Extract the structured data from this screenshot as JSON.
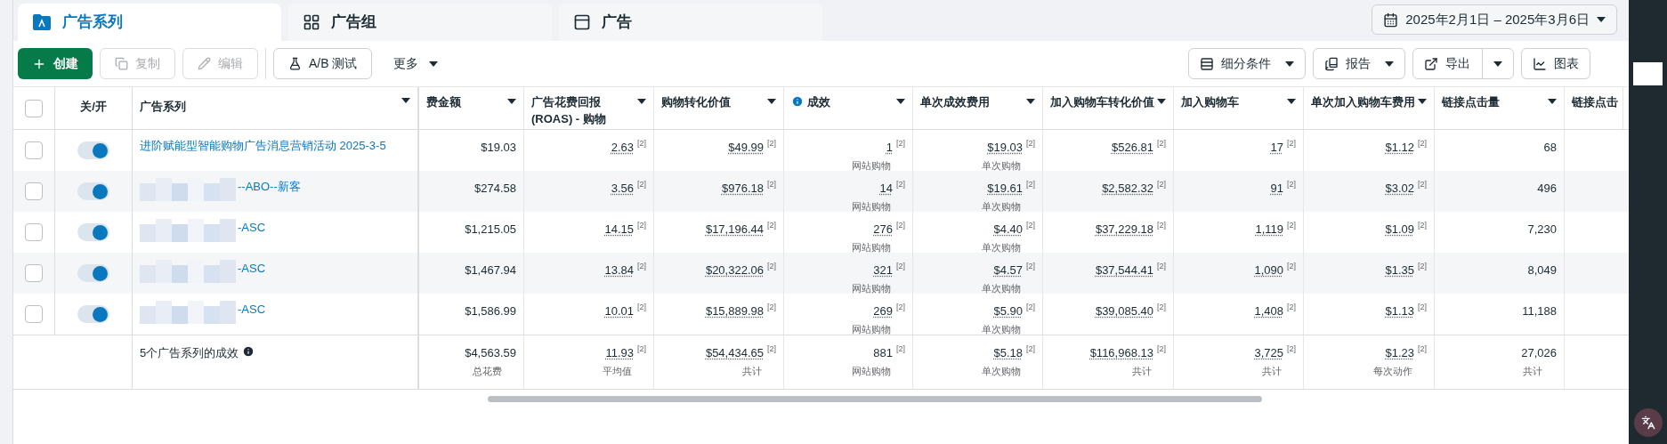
{
  "tabs": [
    {
      "label": "广告系列",
      "kind": "campaign",
      "selected": true
    },
    {
      "label": "广告组",
      "kind": "adset",
      "selected": false
    },
    {
      "label": "广告",
      "kind": "ad",
      "selected": false
    }
  ],
  "date_range": "2025年2月1日 – 2025年3月6日",
  "toolbar_left": [
    {
      "label": "创建",
      "kind": "create",
      "disabled": false
    },
    {
      "label": "复制",
      "kind": "copy",
      "disabled": true
    },
    {
      "label": "编辑",
      "kind": "edit",
      "disabled": true
    },
    {
      "label": "A/B 测试",
      "kind": "ab",
      "disabled": false
    },
    {
      "label": "更多",
      "kind": "more",
      "disabled": false
    }
  ],
  "toolbar_right": [
    {
      "label": "细分条件",
      "kind": "breakdown"
    },
    {
      "label": "报告",
      "kind": "report"
    },
    {
      "label": "导出",
      "kind": "export"
    },
    {
      "label": "图表",
      "kind": "chart"
    }
  ],
  "table": {
    "select_all_checked": false,
    "toggle_header": "关/开",
    "name_header": "广告系列",
    "columns": [
      {
        "label": "费金额"
      },
      {
        "label": "广告花费回报 (ROAS) - 购物"
      },
      {
        "label": "购物转化价值"
      },
      {
        "label": "成效",
        "info": true
      },
      {
        "label": "单次成效费用"
      },
      {
        "label": "加入购物车转化价值"
      },
      {
        "label": "加入购物车"
      },
      {
        "label": "单次加入购物车费用"
      },
      {
        "label": "链接点击量"
      },
      {
        "label": "链接点击"
      }
    ],
    "rows": [
      {
        "checked": false,
        "on": true,
        "name": "进阶赋能型智能购物广告消息营销活动 2025-3-5",
        "redacted": false,
        "cells": [
          {
            "text": "$19.03",
            "dotted": false
          },
          {
            "text": "2.63",
            "note": "[2]",
            "dotted": true
          },
          {
            "text": "$49.99",
            "note": "[2]",
            "dotted": true
          },
          {
            "text": "1",
            "note": "[2]",
            "sub": "网站购物",
            "dotted": true
          },
          {
            "text": "$19.03",
            "note": "[2]",
            "sub": "单次购物",
            "dotted": true
          },
          {
            "text": "$526.81",
            "note": "[2]",
            "dotted": true
          },
          {
            "text": "17",
            "note": "[2]",
            "dotted": true
          },
          {
            "text": "$1.12",
            "note": "[2]",
            "dotted": true
          },
          {
            "text": "68",
            "dotted": false
          }
        ]
      },
      {
        "checked": false,
        "on": true,
        "name": "--ABO--新客",
        "redacted": true,
        "cells": [
          {
            "text": "$274.58",
            "dotted": false
          },
          {
            "text": "3.56",
            "note": "[2]",
            "dotted": true
          },
          {
            "text": "$976.18",
            "note": "[2]",
            "dotted": true
          },
          {
            "text": "14",
            "note": "[2]",
            "sub": "网站购物",
            "dotted": true
          },
          {
            "text": "$19.61",
            "note": "[2]",
            "sub": "单次购物",
            "dotted": true
          },
          {
            "text": "$2,582.32",
            "note": "[2]",
            "dotted": true
          },
          {
            "text": "91",
            "note": "[2]",
            "dotted": true
          },
          {
            "text": "$3.02",
            "note": "[2]",
            "dotted": true
          },
          {
            "text": "496",
            "dotted": false
          }
        ]
      },
      {
        "checked": false,
        "on": true,
        "name": "-ASC",
        "redacted": true,
        "cells": [
          {
            "text": "$1,215.05",
            "dotted": false
          },
          {
            "text": "14.15",
            "note": "[2]",
            "dotted": true
          },
          {
            "text": "$17,196.44",
            "note": "[2]",
            "dotted": true
          },
          {
            "text": "276",
            "note": "[2]",
            "sub": "网站购物",
            "dotted": true
          },
          {
            "text": "$4.40",
            "note": "[2]",
            "sub": "单次购物",
            "dotted": true
          },
          {
            "text": "$37,229.18",
            "note": "[2]",
            "dotted": true
          },
          {
            "text": "1,119",
            "note": "[2]",
            "dotted": true
          },
          {
            "text": "$1.09",
            "note": "[2]",
            "dotted": true
          },
          {
            "text": "7,230",
            "dotted": false
          }
        ]
      },
      {
        "checked": false,
        "on": true,
        "name": "-ASC",
        "redacted": true,
        "cells": [
          {
            "text": "$1,467.94",
            "dotted": false
          },
          {
            "text": "13.84",
            "note": "[2]",
            "dotted": true
          },
          {
            "text": "$20,322.06",
            "note": "[2]",
            "dotted": true
          },
          {
            "text": "321",
            "note": "[2]",
            "sub": "网站购物",
            "dotted": true
          },
          {
            "text": "$4.57",
            "note": "[2]",
            "sub": "单次购物",
            "dotted": true
          },
          {
            "text": "$37,544.41",
            "note": "[2]",
            "dotted": true
          },
          {
            "text": "1,090",
            "note": "[2]",
            "dotted": true
          },
          {
            "text": "$1.35",
            "note": "[2]",
            "dotted": true
          },
          {
            "text": "8,049",
            "dotted": false
          }
        ]
      },
      {
        "checked": false,
        "on": true,
        "name": "-ASC",
        "redacted": true,
        "cells": [
          {
            "text": "$1,586.99",
            "dotted": false
          },
          {
            "text": "10.01",
            "note": "[2]",
            "dotted": true
          },
          {
            "text": "$15,889.98",
            "note": "[2]",
            "dotted": true
          },
          {
            "text": "269",
            "note": "[2]",
            "sub": "网站购物",
            "dotted": true
          },
          {
            "text": "$5.90",
            "note": "[2]",
            "sub": "单次购物",
            "dotted": true
          },
          {
            "text": "$39,085.40",
            "note": "[2]",
            "dotted": true
          },
          {
            "text": "1,408",
            "note": "[2]",
            "dotted": true
          },
          {
            "text": "$1.13",
            "note": "[2]",
            "dotted": true
          },
          {
            "text": "11,188",
            "dotted": false
          }
        ]
      }
    ],
    "total": {
      "label": "5个广告系列的成效",
      "cells": [
        {
          "text": "$4,563.59",
          "sub": "总花费",
          "dotted": false
        },
        {
          "text": "11.93",
          "note": "[2]",
          "sub": "平均值",
          "dotted": true
        },
        {
          "text": "$54,434.65",
          "note": "[2]",
          "sub": "共计",
          "dotted": true
        },
        {
          "text": "881",
          "note": "[2]",
          "sub": "网站购物",
          "dotted": false
        },
        {
          "text": "$5.18",
          "note": "[2]",
          "sub": "单次购物",
          "dotted": true
        },
        {
          "text": "$116,968.13",
          "note": "[2]",
          "sub": "共计",
          "dotted": true
        },
        {
          "text": "3,725",
          "note": "[2]",
          "sub": "共计",
          "dotted": true
        },
        {
          "text": "$1.23",
          "note": "[2]",
          "sub": "每次动作",
          "dotted": true
        },
        {
          "text": "27,026",
          "sub": "共计",
          "dotted": false
        }
      ]
    }
  }
}
